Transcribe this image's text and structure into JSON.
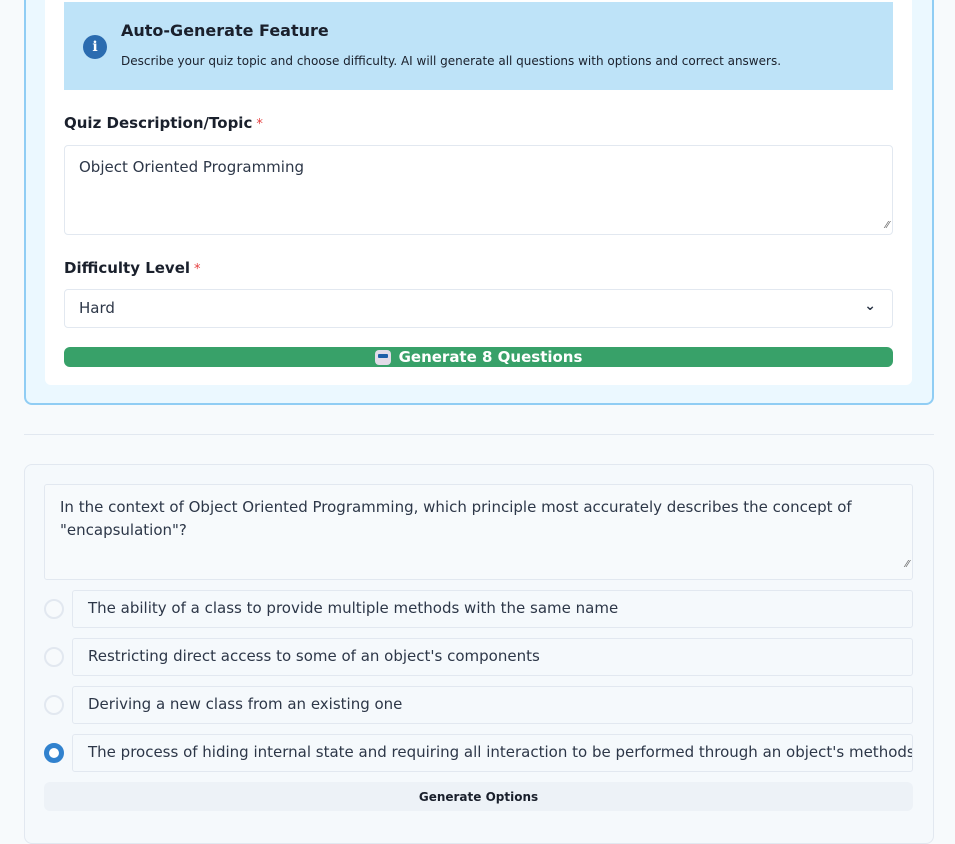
{
  "info": {
    "icon": "info-icon",
    "title": "Auto-Generate Feature",
    "description": "Describe your quiz topic and choose difficulty. AI will generate all questions with options and correct answers."
  },
  "topic": {
    "label": "Quiz Description/Topic",
    "required": "*",
    "value": "Object Oriented Programming"
  },
  "difficulty": {
    "label": "Difficulty Level",
    "required": "*",
    "value": "Hard"
  },
  "generate_button": {
    "icon": "robot-icon",
    "label": "Generate 8 Questions"
  },
  "question": {
    "text": "In the context of Object Oriented Programming, which principle most accurately describes the concept of \"encapsulation\"?",
    "options": [
      {
        "text": "The ability of a class to provide multiple methods with the same name",
        "selected": false
      },
      {
        "text": "Restricting direct access to some of an object's components",
        "selected": false
      },
      {
        "text": "Deriving a new class from an existing one",
        "selected": false
      },
      {
        "text": "The process of hiding internal state and requiring all interaction to be performed through an object's methods",
        "selected": true
      }
    ],
    "generate_options_label": "Generate Options"
  },
  "colors": {
    "accent": "#3182ce",
    "generate": "#38a169",
    "info_bg": "#bee3f8"
  }
}
